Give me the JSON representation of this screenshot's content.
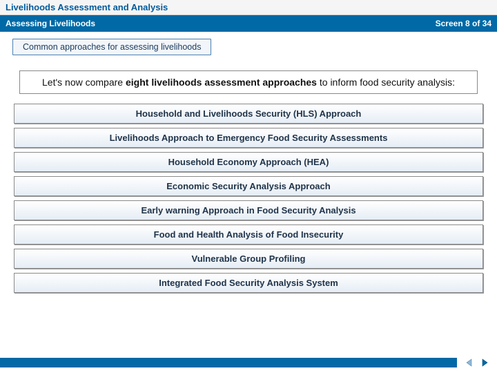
{
  "title": "Livelihoods Assessment and Analysis",
  "header": {
    "subtitle": "Assessing Livelihoods",
    "screen_label": "Screen 8 of 34"
  },
  "section_chip": "Common approaches for assessing livelihoods",
  "intro": {
    "prefix": "Let's now compare ",
    "bold": "eight livelihoods assessment approaches",
    "suffix": " to inform food security analysis:"
  },
  "approaches": [
    "Household and Livelihoods Security (HLS) Approach",
    "Livelihoods Approach to Emergency Food Security Assessments",
    "Household Economy Approach (HEA)",
    "Economic Security Analysis Approach",
    "Early warning Approach in Food Security Analysis",
    "Food and Health Analysis of Food Insecurity",
    "Vulnerable Group Profiling",
    "Integrated Food Security Analysis System"
  ],
  "colors": {
    "brand": "#0069a6",
    "accent": "#005a9c"
  }
}
